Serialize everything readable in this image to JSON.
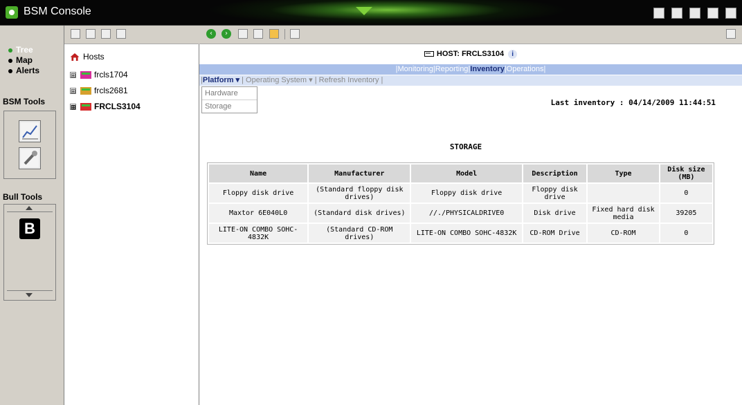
{
  "app": {
    "title": "BSM Console"
  },
  "nav": {
    "items": [
      {
        "label": "Tree"
      },
      {
        "label": "Map"
      },
      {
        "label": "Alerts"
      }
    ],
    "bsm_tools_label": "BSM Tools",
    "bull_tools_label": "Bull Tools"
  },
  "tree": {
    "root": "Hosts",
    "nodes": [
      {
        "label": "frcls1704",
        "expander": "⊞",
        "color": "#d62e9a"
      },
      {
        "label": "frcls2681",
        "expander": "⊞",
        "color": "#d6a02e"
      },
      {
        "label": "FRCLS3104",
        "expander": "⊞",
        "color": "#d62e2e"
      }
    ]
  },
  "host": {
    "title": "HOST: FRCLS3104"
  },
  "tabs": {
    "items": [
      "Monitoring",
      "Reporting",
      "Inventory",
      "Operations"
    ],
    "active": "Inventory"
  },
  "subtabs": {
    "platform": "Platform",
    "operating_system": "Operating System",
    "refresh": "Refresh Inventory"
  },
  "platform_menu": {
    "items": [
      "Hardware",
      "Storage"
    ]
  },
  "last_inventory": "Last inventory : 04/14/2009 11:44:51",
  "storage": {
    "title": "STORAGE",
    "columns": [
      "Name",
      "Manufacturer",
      "Model",
      "Description",
      "Type",
      "Disk size (MB)"
    ],
    "rows": [
      [
        "Floppy disk drive",
        "(Standard floppy disk drives)",
        "Floppy disk drive",
        "Floppy disk drive",
        "",
        "0"
      ],
      [
        "Maxtor 6E040L0",
        "(Standard disk drives)",
        "//./PHYSICALDRIVE0",
        "Disk drive",
        "Fixed hard disk media",
        "39205"
      ],
      [
        "LITE-ON COMBO SOHC-4832K",
        "(Standard CD-ROM drives)",
        "LITE-ON COMBO SOHC-4832K",
        "CD-ROM Drive",
        "CD-ROM",
        "0"
      ]
    ]
  }
}
